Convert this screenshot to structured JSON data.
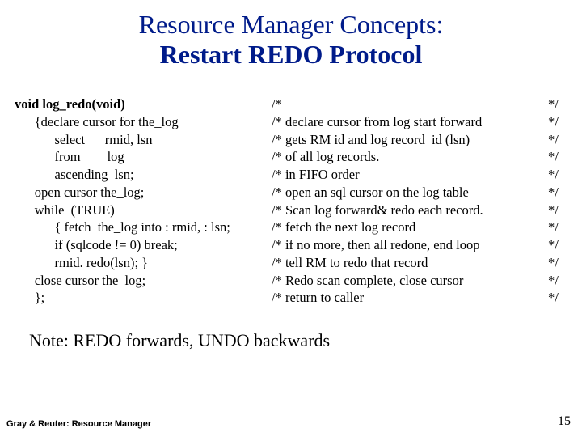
{
  "title": {
    "line1": "Resource Manager Concepts:",
    "line2": "Restart REDO Protocol"
  },
  "code": [
    {
      "indent": 0,
      "text": "void log_redo(void)",
      "bold": true
    },
    {
      "indent": 1,
      "text": "{declare cursor for the_log"
    },
    {
      "indent": 2,
      "text": "select      rmid, lsn"
    },
    {
      "indent": 2,
      "text": "from        log"
    },
    {
      "indent": 2,
      "text": "ascending  lsn;"
    },
    {
      "indent": 1,
      "text": "open cursor the_log;"
    },
    {
      "indent": 1,
      "text": "while  (TRUE)"
    },
    {
      "indent": 2,
      "text": "{ fetch  the_log into : rmid, : lsn;"
    },
    {
      "indent": 2,
      "text": "if (sqlcode != 0) break;"
    },
    {
      "indent": 2,
      "text": "rmid. redo(lsn); }"
    },
    {
      "indent": 1,
      "text": "close cursor the_log;"
    },
    {
      "indent": 1,
      "text": "};"
    }
  ],
  "comments": [
    "/*",
    "/* declare cursor from log start forward",
    "/* gets RM id and log record  id (lsn)",
    "/* of all log records.",
    "/* in FIFO order",
    "/* open an sql cursor on the log table",
    "/* Scan log forward& redo each record.",
    "/* fetch the next log record",
    "/* if no more, then all redone, end loop",
    "/* tell RM to redo that record",
    "/* Redo scan complete, close cursor",
    "/* return to caller"
  ],
  "end": [
    "*/",
    "*/",
    "*/",
    "*/",
    "*/",
    "*/",
    "*/",
    "*/",
    "*/",
    "*/",
    "*/",
    "*/"
  ],
  "note": "Note: REDO forwards, UNDO backwards",
  "footer": {
    "left": "Gray & Reuter: Resource Manager",
    "right": "15"
  }
}
